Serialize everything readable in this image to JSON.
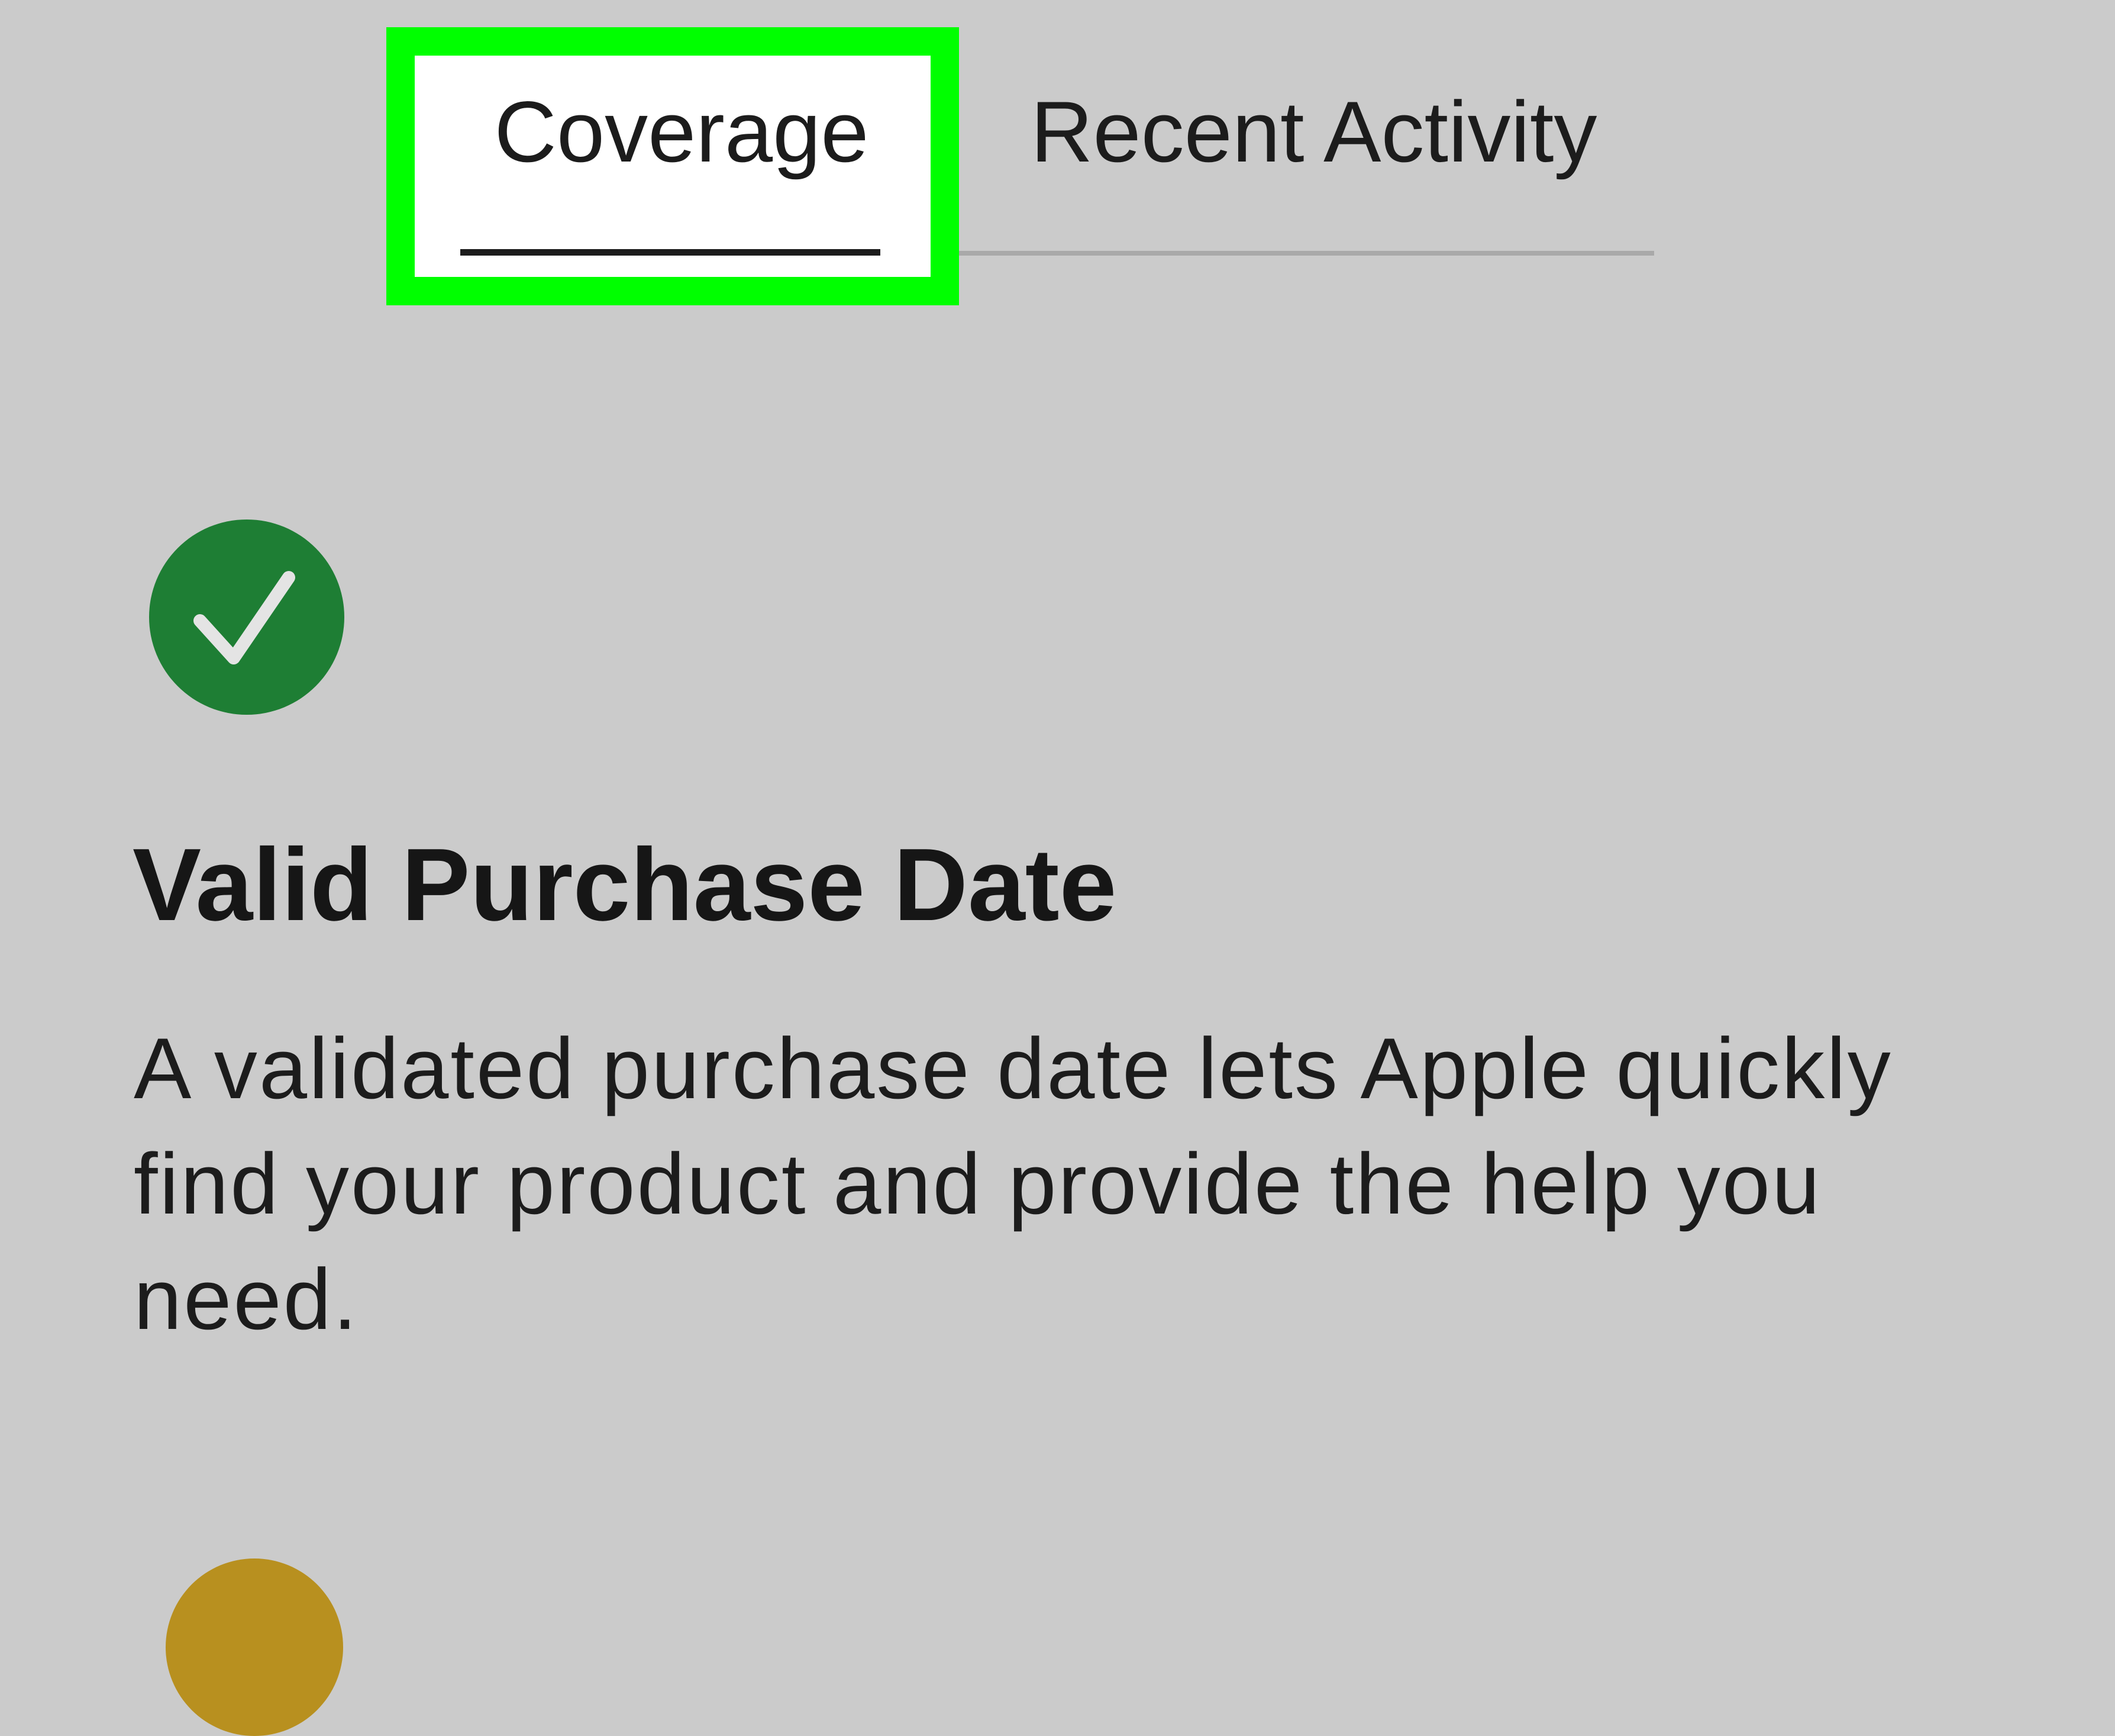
{
  "tabs": {
    "coverage_label": "Coverage",
    "recent_activity_label": "Recent Activity",
    "selected": "Coverage"
  },
  "status_item": {
    "icon": "checkmark-circle-icon",
    "title": "Valid Purchase Date",
    "description": "A validated purchase date lets Apple quickly find your product and provide the help you need."
  },
  "next_item": {
    "icon": "status-circle-icon"
  },
  "colors": {
    "background": "#cbcbcb",
    "highlight": "#00ff00",
    "success_green": "#1e7e34",
    "warning_gold": "#b8901f"
  }
}
